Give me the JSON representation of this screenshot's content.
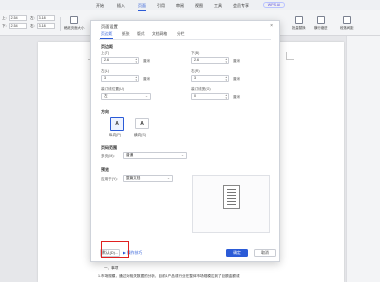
{
  "ribbon": {
    "menu": [
      "开始",
      "插入",
      "页面",
      "引用",
      "审阅",
      "视图",
      "工具",
      "会员专享"
    ],
    "active_menu": "页面",
    "wps_ai": "WPS AI",
    "margins": {
      "top_label": "上:",
      "top_value": "2.54",
      "bottom_label": "下:",
      "bottom_value": "2.54",
      "left_label": "左:",
      "left_value": "3.18",
      "right_label": "右:",
      "right_value": "3.18"
    },
    "buttons": [
      "稿纸页面大小",
      "主题",
      "纸张方向",
      "纸张大小",
      "文字方向",
      "页面边框",
      "背景",
      "批量替换",
      "横行缩进",
      "段落间距"
    ]
  },
  "document": {
    "lines": [
      "二、系统",
      "（一）",
      "（二）",
      "1.",
      "2.",
      "任务 1：",
      "1.",
      "任务 2：",
      "任务 3：",
      "问题 1：",
      "3.",
      "任务 1：",
      "4.",
      "三、结论",
      "（一）",
      "一、事项",
      "综上所述，结合上述数据的分析，",
      "1.市场规模，通过对相关数据的分析，目前1产品或行业在整体市场规模达到了巨额金额或"
    ]
  },
  "dialog": {
    "title": "页面设置",
    "close": "×",
    "tabs": [
      "页边距",
      "纸张",
      "版式",
      "文档网格",
      "分栏"
    ],
    "active_tab": "页边距",
    "margins_section": "页边距",
    "top_label": "上(T)",
    "top_value": "2.6",
    "bottom_label": "下(B)",
    "bottom_value": "2.6",
    "left_label": "左(L)",
    "left_value": "3",
    "right_label": "右(R)",
    "right_value": "3",
    "gutter_pos_label": "装订线位置(U)",
    "gutter_pos_value": "左",
    "gutter_width_label": "装订线宽(G)",
    "gutter_width_value": "0",
    "unit": "厘米",
    "orientation_section": "方向",
    "portrait_label": "纵向(P)",
    "landscape_label": "横向(S)",
    "pages_section": "页码范围",
    "multi_pages_label": "多页(M):",
    "multi_pages_value": "普通",
    "preview_section": "预览",
    "apply_label": "应用于(Y):",
    "apply_value": "整篇文档",
    "default_button": "默认(D)...",
    "tips_link": "操作技巧",
    "ok_button": "确定",
    "cancel_button": "取消"
  }
}
